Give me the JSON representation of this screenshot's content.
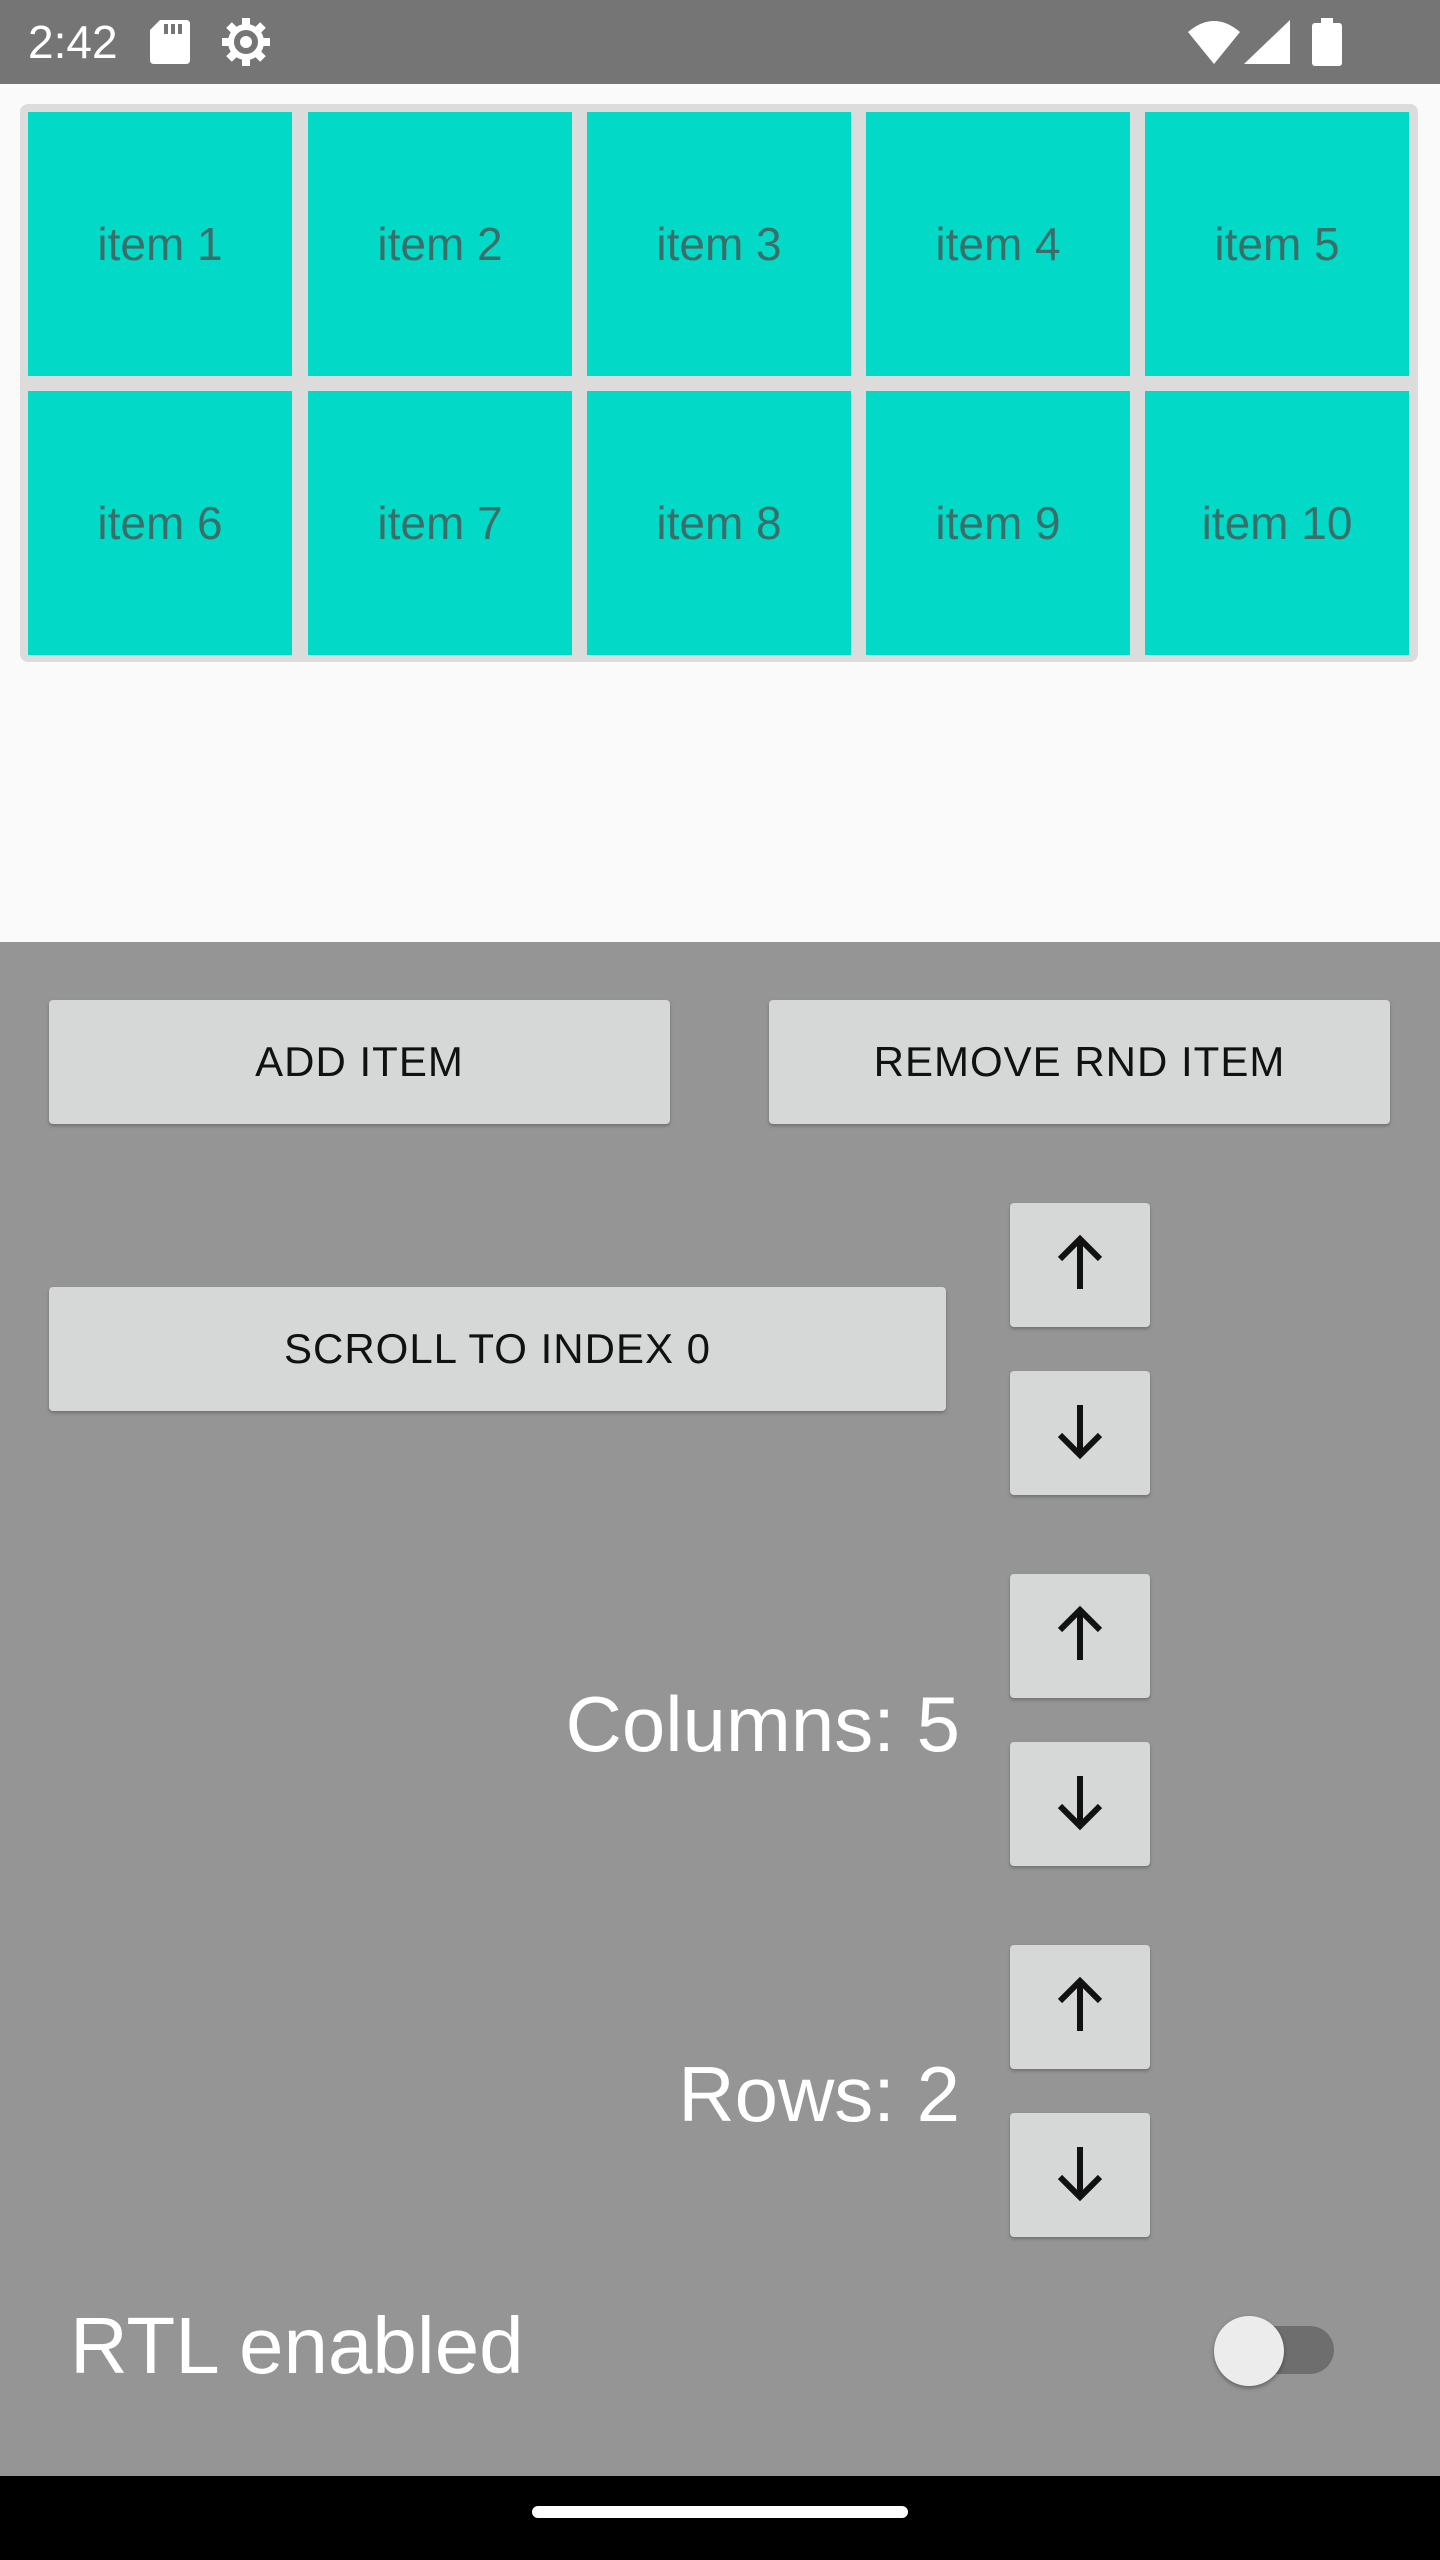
{
  "status_bar": {
    "time": "2:42",
    "icons": [
      "sd-card-icon",
      "settings-icon",
      "wifi-icon",
      "signal-icon",
      "battery-icon"
    ]
  },
  "grid": {
    "items": [
      "item 1",
      "item 2",
      "item 3",
      "item 4",
      "item 5",
      "item 6",
      "item 7",
      "item 8",
      "item 9",
      "item 10"
    ],
    "cell_color": "#02d9c6"
  },
  "buttons": {
    "add_item": "ADD ITEM",
    "remove_rnd_item": "REMOVE RND ITEM",
    "scroll_to_index": "SCROLL TO INDEX 0"
  },
  "columns": {
    "label": "Columns: 5"
  },
  "rows": {
    "label": "Rows: 2"
  },
  "rtl": {
    "label": "RTL enabled",
    "enabled": false
  }
}
